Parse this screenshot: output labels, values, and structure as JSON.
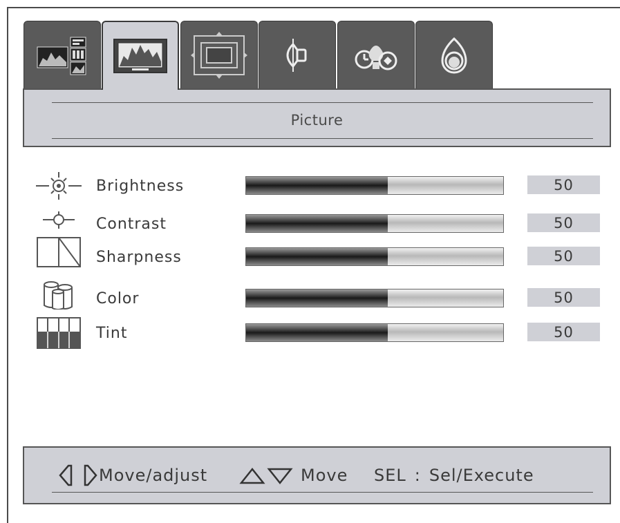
{
  "tabs": [
    {
      "name": "tab-input",
      "icon": "input-select-icon"
    },
    {
      "name": "tab-picture",
      "icon": "picture-icon",
      "active": true
    },
    {
      "name": "tab-display",
      "icon": "display-position-icon"
    },
    {
      "name": "tab-audio",
      "icon": "speaker-icon"
    },
    {
      "name": "tab-setup",
      "icon": "timer-lamp-icon"
    },
    {
      "name": "tab-advanced",
      "icon": "advanced-icon"
    }
  ],
  "menu": {
    "title": "Picture"
  },
  "settings": [
    {
      "label": "Brightness",
      "value": "50",
      "level": 0.55,
      "icon": "brightness-icon"
    },
    {
      "label": "Contrast",
      "value": "50",
      "level": 0.55,
      "icon": "contrast-icon"
    },
    {
      "label": "Sharpness",
      "value": "50",
      "level": 0.55,
      "icon": "sharpness-icon"
    },
    {
      "label": "Color",
      "value": "50",
      "level": 0.55,
      "icon": "color-icon"
    },
    {
      "label": "Tint",
      "value": "50",
      "level": 0.55,
      "icon": "tint-icon"
    }
  ],
  "help": {
    "move_adjust": "Move/adjust",
    "move": "Move",
    "sel_key": "SEL",
    "separator": ":",
    "sel_execute": "Sel/Execute"
  },
  "colors": {
    "tab_bg": "#5a5a5a",
    "panel_bg": "#cfd0d6",
    "text": "#3a3a3a"
  }
}
